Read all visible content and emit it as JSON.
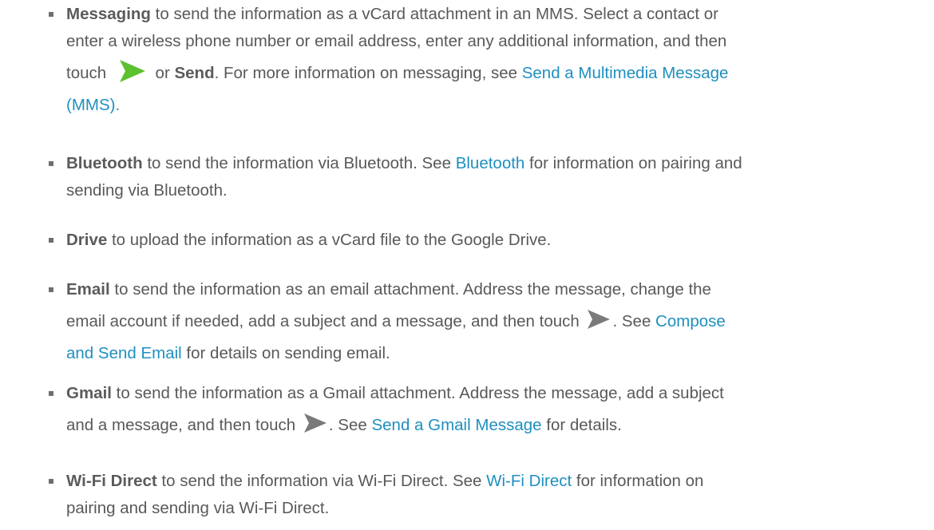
{
  "items": [
    {
      "term": "Messaging",
      "l1_text": " to send the information as a vCard attachment in an MMS. Select a contact or",
      "l2_text": "enter a wireless phone number or email address, enter any additional information, and then",
      "l3_pre": "touch ",
      "l3_mid": " or ",
      "l3_bold": "Send",
      "l3_post": ". For more information on messaging, see ",
      "link_l3": "Send a Multimedia Message",
      "link_l4": "(MMS)",
      "l4_post": ".",
      "icon": "green-send-arrow-icon"
    },
    {
      "term": "Bluetooth",
      "l1_pre": " to send the information via Bluetooth. See ",
      "link": "Bluetooth",
      "l1_post": " for information on pairing and",
      "l2_text": "sending via Bluetooth."
    },
    {
      "term": "Drive",
      "l1_text": " to upload the information as a vCard file to the Google Drive."
    },
    {
      "term": "Email",
      "l1_text": " to send the information as an email attachment. Address the message, change the",
      "l2_pre": "email account if needed, add a subject and a message, and then touch ",
      "l2_post": ". See ",
      "link_l2": "Compose",
      "link_l3": "and Send Email",
      "l3_post": " for details on sending email.",
      "icon": "gray-send-arrow-icon"
    },
    {
      "term": "Gmail",
      "l1_text": " to send the information as a Gmail attachment. Address the message, add a subject",
      "l2_pre": "and a message, and then touch ",
      "l2_mid": ". See ",
      "link": "Send a Gmail Message",
      "l2_post": " for details.",
      "icon": "gray-send-arrow-icon"
    },
    {
      "term": "Wi-Fi Direct",
      "l1_pre": " to send the information via Wi-Fi Direct. See ",
      "link": "Wi-Fi Direct",
      "l1_post": " for information on",
      "l2_text": "pairing and sending via Wi-Fi Direct."
    }
  ],
  "colors": {
    "text": "#58595b",
    "link": "#1f8fbf",
    "bullet": "#6d6e71",
    "send_green": "#5cc12f",
    "send_gray": "#7a7a7a"
  }
}
